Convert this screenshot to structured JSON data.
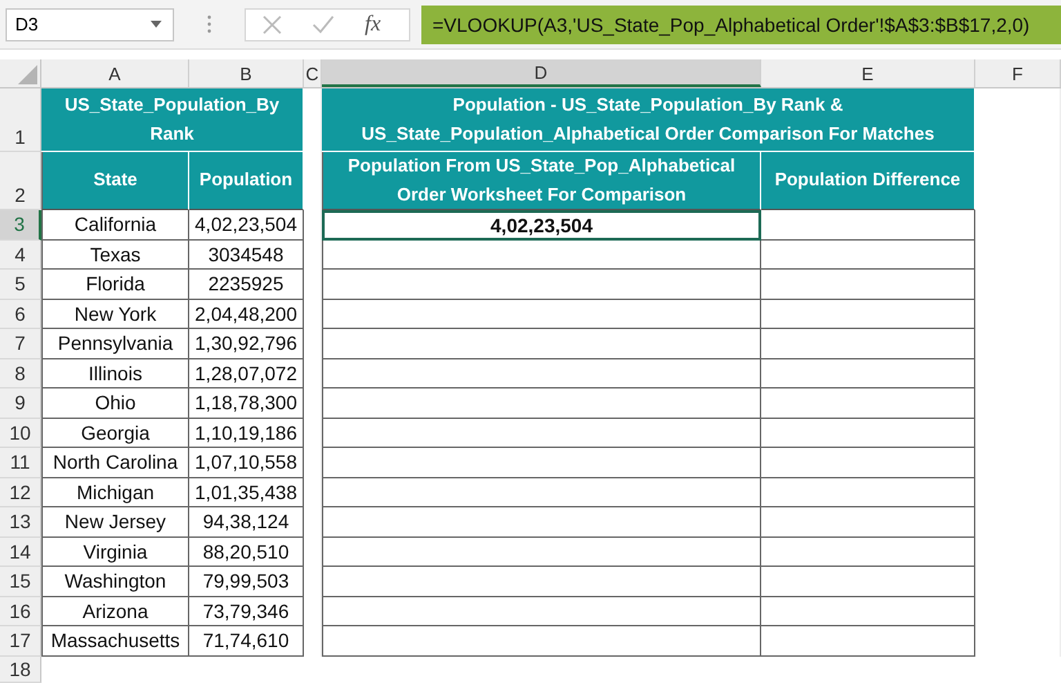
{
  "name_box": {
    "value": "D3"
  },
  "formula_bar": {
    "function_label": "fx",
    "formula": "=VLOOKUP(A3,'US_State_Pop_Alphabetical Order'!$A$3:$B$17,2,0)"
  },
  "columns": [
    {
      "label": "A",
      "selected": false
    },
    {
      "label": "B",
      "selected": false
    },
    {
      "label": "C",
      "selected": false
    },
    {
      "label": "D",
      "selected": true
    },
    {
      "label": "E",
      "selected": false
    },
    {
      "label": "F",
      "selected": false
    }
  ],
  "row_numbers": [
    {
      "label": "1",
      "selected": false
    },
    {
      "label": "2",
      "selected": false
    },
    {
      "label": "3",
      "selected": true
    },
    {
      "label": "4",
      "selected": false
    },
    {
      "label": "5",
      "selected": false
    },
    {
      "label": "6",
      "selected": false
    },
    {
      "label": "7",
      "selected": false
    },
    {
      "label": "8",
      "selected": false
    },
    {
      "label": "9",
      "selected": false
    },
    {
      "label": "10",
      "selected": false
    },
    {
      "label": "11",
      "selected": false
    },
    {
      "label": "12",
      "selected": false
    },
    {
      "label": "13",
      "selected": false
    },
    {
      "label": "14",
      "selected": false
    },
    {
      "label": "15",
      "selected": false
    },
    {
      "label": "16",
      "selected": false
    },
    {
      "label": "17",
      "selected": false
    },
    {
      "label": "18",
      "selected": false
    }
  ],
  "left_table": {
    "title": "US_State_Population_By Rank",
    "headers": [
      "State",
      "Population"
    ],
    "rows": [
      {
        "state": "California",
        "population": "4,02,23,504"
      },
      {
        "state": "Texas",
        "population": "3034548"
      },
      {
        "state": "Florida",
        "population": "2235925"
      },
      {
        "state": "New York",
        "population": "2,04,48,200"
      },
      {
        "state": "Pennsylvania",
        "population": "1,30,92,796"
      },
      {
        "state": "Illinois",
        "population": "1,28,07,072"
      },
      {
        "state": "Ohio",
        "population": "1,18,78,300"
      },
      {
        "state": "Georgia",
        "population": "1,10,19,186"
      },
      {
        "state": "North Carolina",
        "population": "1,07,10,558"
      },
      {
        "state": "Michigan",
        "population": "1,01,35,438"
      },
      {
        "state": "New Jersey",
        "population": "94,38,124"
      },
      {
        "state": "Virginia",
        "population": "88,20,510"
      },
      {
        "state": "Washington",
        "population": "79,99,503"
      },
      {
        "state": "Arizona",
        "population": "73,79,346"
      },
      {
        "state": "Massachusetts",
        "population": "71,74,610"
      }
    ]
  },
  "right_table": {
    "title": "Population - US_State_Population_By Rank & US_State_Population_Alphabetical Order Comparison For Matches",
    "headers": [
      "Population From US_State_Pop_Alphabetical Order Worksheet For Comparison",
      "Population Difference"
    ],
    "rows": [
      {
        "population": "4,02,23,504",
        "selected": true
      },
      {
        "selected": false
      },
      {
        "selected": false
      },
      {
        "selected": false
      },
      {
        "selected": false
      },
      {
        "selected": false
      },
      {
        "selected": false
      },
      {
        "selected": false
      },
      {
        "selected": false
      },
      {
        "selected": false
      },
      {
        "selected": false
      },
      {
        "selected": false
      },
      {
        "selected": false
      },
      {
        "selected": false
      },
      {
        "selected": false
      }
    ]
  }
}
